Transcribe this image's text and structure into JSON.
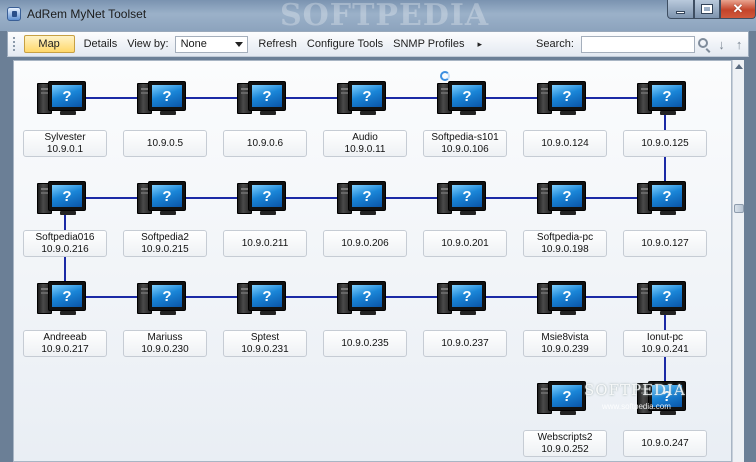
{
  "window": {
    "title": "AdRem MyNet Toolset",
    "watermark": "SOFTPEDIA"
  },
  "toolbar": {
    "map_label": "Map",
    "details_label": "Details",
    "viewby_label": "View by:",
    "viewby_value": "None",
    "refresh_label": "Refresh",
    "configure_label": "Configure Tools",
    "snmp_label": "SNMP Profiles",
    "more_label": "▸",
    "search_label": "Search:",
    "search_value": ""
  },
  "nodes": [
    {
      "name": "Sylvester",
      "ip": "10.9.0.1"
    },
    {
      "name": "",
      "ip": "10.9.0.5"
    },
    {
      "name": "",
      "ip": "10.9.0.6"
    },
    {
      "name": "Audio",
      "ip": "10.9.0.11"
    },
    {
      "name": "Softpedia-s101",
      "ip": "10.9.0.106"
    },
    {
      "name": "",
      "ip": "10.9.0.124"
    },
    {
      "name": "",
      "ip": "10.9.0.125"
    },
    {
      "name": "Softpedia016",
      "ip": "10.9.0.216"
    },
    {
      "name": "Softpedia2",
      "ip": "10.9.0.215"
    },
    {
      "name": "",
      "ip": "10.9.0.211"
    },
    {
      "name": "",
      "ip": "10.9.0.206"
    },
    {
      "name": "",
      "ip": "10.9.0.201"
    },
    {
      "name": "Softpedia-pc",
      "ip": "10.9.0.198"
    },
    {
      "name": "",
      "ip": "10.9.0.127"
    },
    {
      "name": "Andreeab",
      "ip": "10.9.0.217"
    },
    {
      "name": "Mariuss",
      "ip": "10.9.0.230"
    },
    {
      "name": "Sptest",
      "ip": "10.9.0.231"
    },
    {
      "name": "",
      "ip": "10.9.0.235"
    },
    {
      "name": "",
      "ip": "10.9.0.237"
    },
    {
      "name": "Msie8vista",
      "ip": "10.9.0.239"
    },
    {
      "name": "Ionut-pc",
      "ip": "10.9.0.241"
    },
    {
      "name": "Webscripts2",
      "ip": "10.9.0.252"
    },
    {
      "name": "",
      "ip": "10.9.0.247"
    }
  ],
  "screen_glyph": "?",
  "watermark_small": "SOFTPEDIA",
  "watermark_url": "www.softpedia.com",
  "colors": {
    "link": "#1b2aa6",
    "map_button": "#ffd86b",
    "screen": "#1a86d8",
    "titlebar": "#8ca3bd"
  },
  "icons": [
    "app-icon",
    "minimize-icon",
    "maximize-icon",
    "close-icon",
    "search-icon",
    "up-arrow-icon",
    "down-arrow-icon",
    "computer-icon"
  ]
}
